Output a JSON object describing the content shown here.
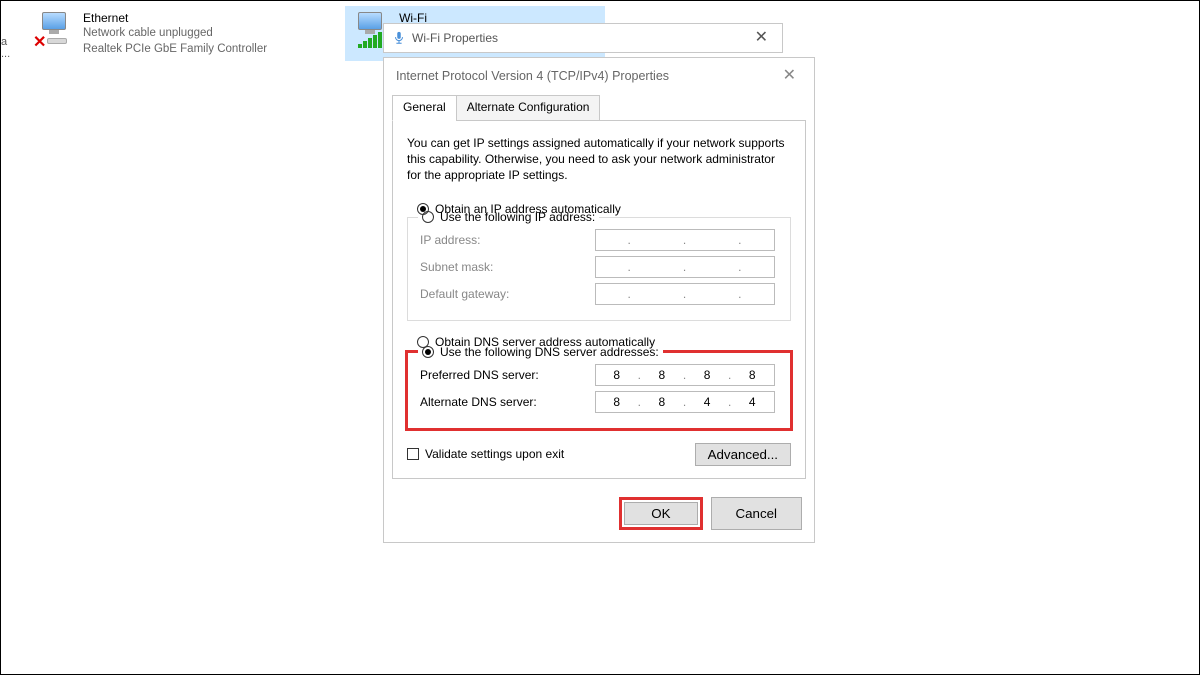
{
  "net": {
    "ethernet": {
      "title": "Ethernet",
      "line1": "Network cable unplugged",
      "line2": "Realtek PCIe GbE Family Controller"
    },
    "wifi": {
      "title": "Wi-Fi"
    },
    "truncated_label": "a ..."
  },
  "wifi_dialog": {
    "title": "Wi-Fi Properties"
  },
  "ipv4": {
    "title": "Internet Protocol Version 4 (TCP/IPv4) Properties",
    "tabs": {
      "general": "General",
      "alt": "Alternate Configuration"
    },
    "intro": "You can get IP settings assigned automatically if your network supports this capability. Otherwise, you need to ask your network administrator for the appropriate IP settings.",
    "ip_auto": "Obtain an IP address automatically",
    "ip_manual": "Use the following IP address:",
    "ip_address_lbl": "IP address:",
    "subnet_lbl": "Subnet mask:",
    "gateway_lbl": "Default gateway:",
    "dns_auto": "Obtain DNS server address automatically",
    "dns_manual": "Use the following DNS server addresses:",
    "pref_dns_lbl": "Preferred DNS server:",
    "alt_dns_lbl": "Alternate DNS server:",
    "pref_dns": {
      "o1": "8",
      "o2": "8",
      "o3": "8",
      "o4": "8"
    },
    "alt_dns": {
      "o1": "8",
      "o2": "8",
      "o3": "4",
      "o4": "4"
    },
    "validate_lbl": "Validate settings upon exit",
    "advanced_btn": "Advanced...",
    "ok": "OK",
    "cancel": "Cancel"
  }
}
